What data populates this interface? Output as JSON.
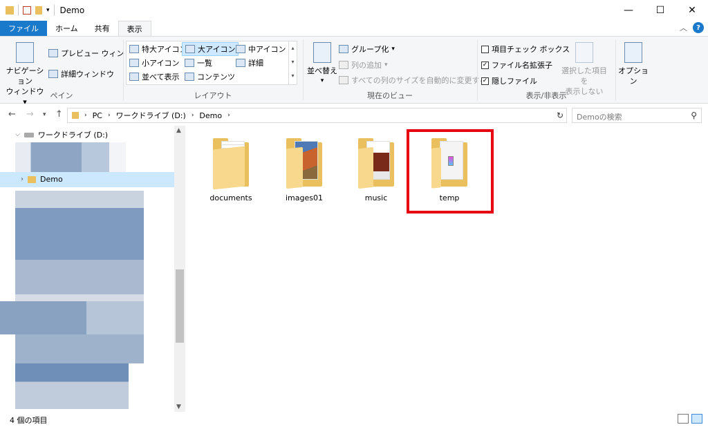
{
  "window": {
    "title": "Demo",
    "minimize": "—",
    "maximize": "☐",
    "close": "✕"
  },
  "tabs": [
    {
      "label": "ファイル"
    },
    {
      "label": "ホーム"
    },
    {
      "label": "共有"
    },
    {
      "label": "表示"
    }
  ],
  "ribbon": {
    "pane": {
      "nav_pane_line1": "ナビゲーション",
      "nav_pane_line2": "ウィンドウ",
      "preview": "プレビュー ウィンドウ",
      "details": "詳細ウィンドウ",
      "label": "ペイン"
    },
    "layout": {
      "extra_large": "特大アイコン",
      "large": "大アイコン",
      "medium": "中アイコン",
      "small": "小アイコン",
      "list": "一覧",
      "detail": "詳細",
      "tiles": "並べて表示",
      "content": "コンテンツ",
      "label": "レイアウト"
    },
    "current_view": {
      "sort": "並べ替え",
      "group": "グループ化",
      "add_column": "列の追加",
      "fit_columns": "すべての列のサイズを自動的に変更する",
      "label": "現在のビュー"
    },
    "show_hide": {
      "item_checkbox": "項目チェック ボックス",
      "file_ext": "ファイル名拡張子",
      "hidden": "隠しファイル",
      "hide_selected_line1": "選択した項目を",
      "hide_selected_line2": "表示しない",
      "options": "オプション",
      "label": "表示/非表示"
    }
  },
  "address": {
    "path": [
      "PC",
      "ワークドライブ (D:)",
      "Demo"
    ],
    "search_placeholder": "Demoの検索"
  },
  "navpane": {
    "drive": "ワークドライブ (D:)",
    "selected": "Demo"
  },
  "folders": [
    {
      "name": "documents"
    },
    {
      "name": "images01"
    },
    {
      "name": "music"
    },
    {
      "name": "temp"
    }
  ],
  "status": {
    "count": "4 個の項目"
  },
  "colors": {
    "accent": "#1979ca",
    "highlight": "#e60012",
    "folder": "#e9c05d"
  }
}
